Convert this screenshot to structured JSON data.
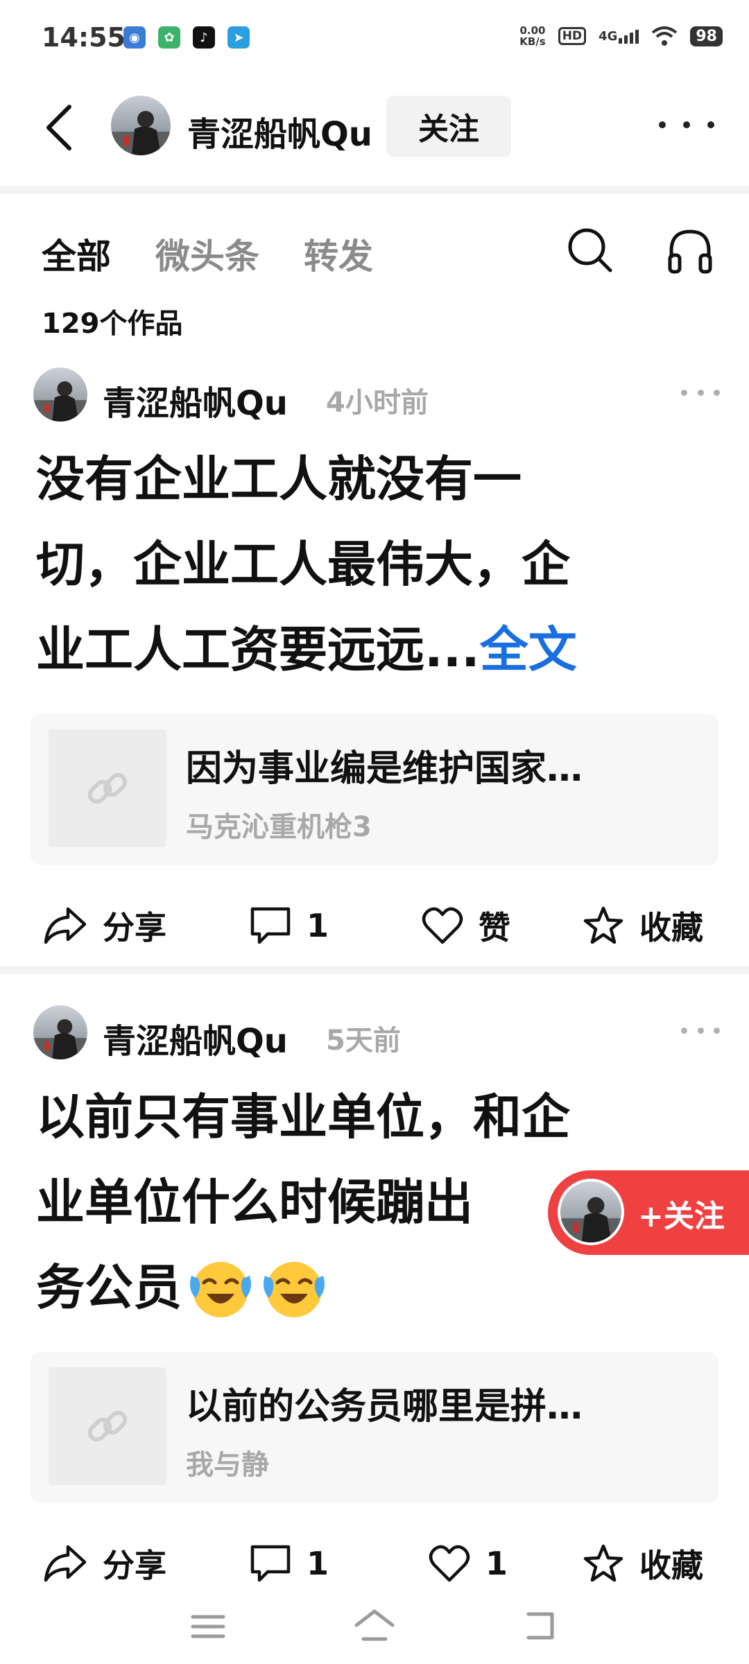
{
  "status_bar": {
    "time": "14:55",
    "net_speed_value": "0.00",
    "net_speed_unit": "KB/s",
    "hd_label": "HD",
    "network_type": "4G",
    "battery": "98"
  },
  "header": {
    "username": "青涩船帆Qu",
    "follow_label": "关注"
  },
  "tabs": [
    {
      "label": "全部",
      "active": true
    },
    {
      "label": "微头条",
      "active": false
    },
    {
      "label": "转发",
      "active": false
    }
  ],
  "works_count": "129个作品",
  "posts": [
    {
      "author": "青涩船帆Qu",
      "time": "4小时前",
      "text_lines": [
        "没有企业工人就没有一",
        "切，企业工人最伟大，企",
        "业工人工资要远远..."
      ],
      "more_link": "全文",
      "link_title": "因为事业编是维护国家…",
      "link_author": "马克沁重机枪3",
      "share_label": "分享",
      "comment_count": "1",
      "like_label": "赞",
      "collect_label": "收藏"
    },
    {
      "author": "青涩船帆Qu",
      "time": "5天前",
      "text_lines": [
        "以前只有事业单位，和企",
        "业单位什么时候蹦出",
        "务公员"
      ],
      "link_title": "以前的公务员哪里是拼…",
      "link_author": "我与静",
      "share_label": "分享",
      "comment_count": "1",
      "like_count": "1",
      "collect_label": "收藏"
    }
  ],
  "floating_follow": {
    "label": "+关注"
  },
  "colors": {
    "accent_red": "#f04142",
    "link_blue": "#1a6fe0"
  }
}
